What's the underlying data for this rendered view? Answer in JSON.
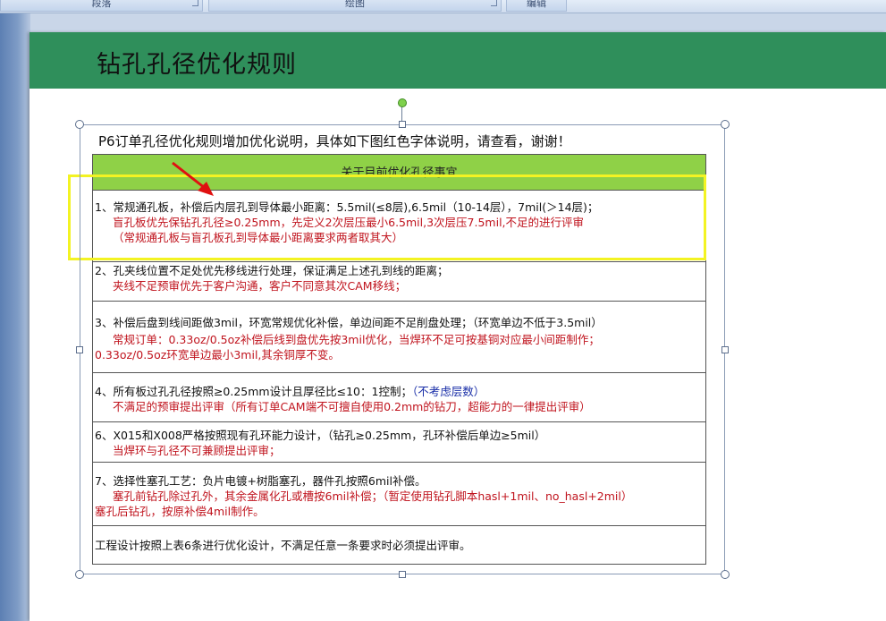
{
  "ribbon": {
    "groups": [
      "段落",
      "绘图",
      "编辑"
    ]
  },
  "slide": {
    "title": "钻孔孔径优化规则"
  },
  "picture": {
    "intro": "P6订单孔径优化规则增加优化说明，具体如下图红色字体说明，请查看，谢谢！",
    "table_header": "关于目前优化孔径事宜",
    "rows": [
      {
        "line1": "1、常规通孔板，补偿后内层孔到导体最小距离：5.5mil(≤8层),6.5mil（10-14层），7mil(＞14层)；",
        "line2": "盲孔板优先保钻孔孔径≥0.25mm，先定义2次层压最小6.5mil,3次层压7.5mil,不足的进行评审",
        "line3": "（常规通孔板与盲孔板孔到导体最小距离要求两者取其大）"
      },
      {
        "line1": "2、孔夹线位置不足处优先移线进行处理，保证满足上述孔到线的距离；",
        "line2": "夹线不足预审优先于客户沟通，客户不同意其次CAM移线；"
      },
      {
        "line1": "3、补偿后盘到线间距做3mil，环宽常规优化补偿，单边间距不足削盘处理；（环宽单边不低于3.5mil）",
        "line2": "常规订单：0.33oz/0.5oz补偿后线到盘优先按3mil优化，当焊环不足可按基铜对应最小间距制作；",
        "line3": "0.33oz/0.5oz环宽单边最小3mil,其余铜厚不变。"
      },
      {
        "line1_black": "4、所有板过孔孔径按照≥0.25mm设计且厚径比≤10：1控制；",
        "line1_blue": "（不考虑层数）",
        "line2": "不满足的预审提出评审（所有订单CAM端不可擅自使用0.2mm的钻刀，超能力的一律提出评审）"
      },
      {
        "line1": "6、X015和X008严格按照现有孔环能力设计，（钻孔≥0.25mm，孔环补偿后单边≥5mil）",
        "line2": "当焊环与孔径不可兼顾提出评审；"
      },
      {
        "line1": "7、选择性塞孔工艺：负片电镀+树脂塞孔，器件孔按照6mil补偿。",
        "line2": "塞孔前钻孔除过孔外，其余金属化孔或槽按6mil补偿；（暂定使用钻孔脚本hasl+1mil、no_hasl+2mil）",
        "line3": "塞孔后钻孔，按原补偿4mil制作。"
      },
      {
        "line1": "工程设计按照上表6条进行优化设计，不满足任意一条要求时必须提出评审。"
      }
    ]
  }
}
